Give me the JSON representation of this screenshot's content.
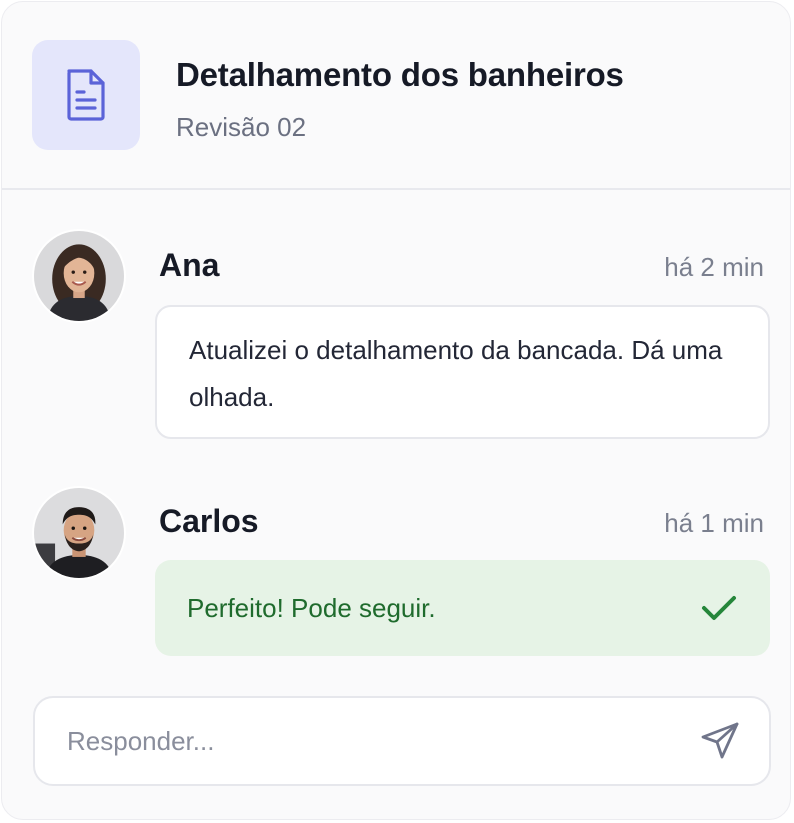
{
  "header": {
    "title": "Detalhamento dos banheiros",
    "subtitle": "Revisão 02",
    "icon": "document-icon"
  },
  "comments": [
    {
      "author": "Ana",
      "time": "há 2 min",
      "text": "Atualizei o detalhamento da bancada. Dá uma olhada.",
      "avatar": "avatar-ana"
    },
    {
      "author": "Carlos",
      "time": "há 1 min",
      "text": "Perfeito! Pode seguir.",
      "avatar": "avatar-carlos",
      "status_icon": "check-icon"
    }
  ],
  "reply": {
    "placeholder": "Responder...",
    "value": "",
    "send_icon": "send-icon"
  },
  "colors": {
    "accent": "#5b63d8",
    "accent_bg": "#e4e6fb",
    "success_text": "#1f6b2d",
    "success_bg": "#e6f3e6",
    "check": "#25863a"
  }
}
